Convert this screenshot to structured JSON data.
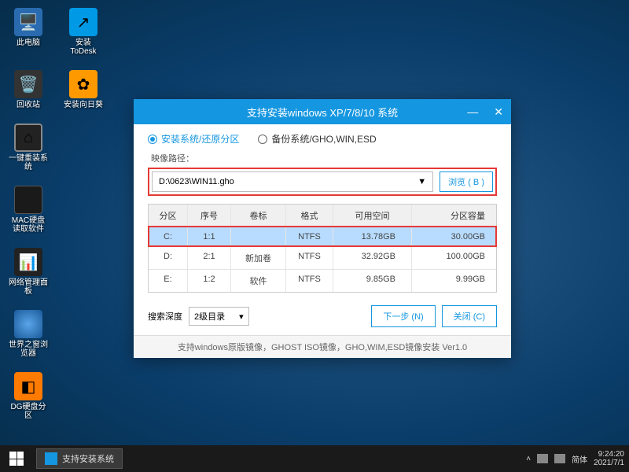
{
  "desktop": {
    "icons": [
      {
        "label": "此电脑"
      },
      {
        "label": "安装ToDesk"
      },
      {
        "label": "回收站"
      },
      {
        "label": "安装向日葵"
      },
      {
        "label": "一键重装系统"
      },
      {
        "label": "MAC硬盘读取软件"
      },
      {
        "label": "网络管理面板"
      },
      {
        "label": "世界之窗浏览器"
      },
      {
        "label": "DG硬盘分区"
      }
    ]
  },
  "window": {
    "title": "支持安装windows XP/7/8/10 系统",
    "tab_install": "安装系统/还原分区",
    "tab_backup": "备份系统/GHO,WIN,ESD",
    "path_label": "映像路径：",
    "path_value": "D:\\0623\\WIN11.gho",
    "browse": "浏览 ( B )",
    "headers": [
      "分区",
      "序号",
      "卷标",
      "格式",
      "可用空间",
      "分区容量"
    ],
    "rows": [
      {
        "drive": "C:",
        "idx": "1:1",
        "vol": "",
        "fs": "NTFS",
        "free": "13.78GB",
        "size": "30.00GB",
        "sel": true
      },
      {
        "drive": "D:",
        "idx": "2:1",
        "vol": "新加卷",
        "fs": "NTFS",
        "free": "32.92GB",
        "size": "100.00GB",
        "sel": false
      },
      {
        "drive": "E:",
        "idx": "1:2",
        "vol": "软件",
        "fs": "NTFS",
        "free": "9.85GB",
        "size": "9.99GB",
        "sel": false
      }
    ],
    "depth_label": "搜索深度",
    "depth_value": "2级目录",
    "next": "下一步 (N)",
    "close": "关闭 (C)",
    "footnote": "支持windows原版镜像，GHOST ISO镜像，GHO,WIM,ESD镜像安装 Ver1.0"
  },
  "taskbar": {
    "task": "支持安装系统",
    "lang": "简体",
    "time": "9:24:20",
    "date": "2021/7/1"
  }
}
